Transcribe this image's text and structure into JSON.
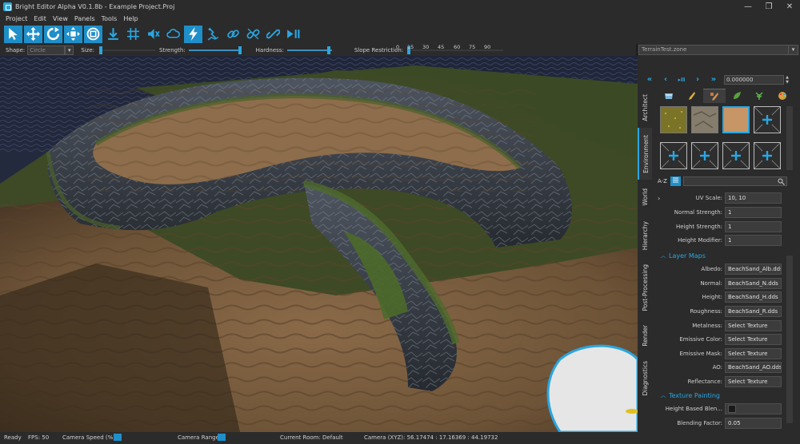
{
  "window": {
    "title": "Bright Editor Alpha V0.1.8b - Example Project.Proj",
    "controls": [
      "—",
      "❐",
      "✕"
    ]
  },
  "menu": [
    "Project",
    "Edit",
    "View",
    "Panels",
    "Tools",
    "Help"
  ],
  "toolbar": {
    "tools": [
      {
        "icon": "select-arrow-icon",
        "active": true
      },
      {
        "icon": "move-icon",
        "active": true
      },
      {
        "icon": "rotate-icon",
        "active": true
      },
      {
        "icon": "scale-icon",
        "active": true
      },
      {
        "icon": "bounds-icon",
        "active": true
      },
      {
        "icon": "drop-to-ground-icon",
        "active": false
      },
      {
        "icon": "grid-icon",
        "active": false
      },
      {
        "icon": "mute-icon",
        "active": false
      },
      {
        "icon": "cloud-icon",
        "active": false
      },
      {
        "icon": "lightning-icon",
        "active": true
      },
      {
        "icon": "terrain-brush-icon",
        "active": false
      },
      {
        "icon": "link-icon",
        "active": false
      },
      {
        "icon": "unlink-icon",
        "active": false
      },
      {
        "icon": "chain-icon",
        "active": false
      },
      {
        "icon": "play-pause-icon",
        "active": false
      }
    ]
  },
  "options": {
    "shape_label": "Shape:",
    "shape_value": "Circle",
    "size_label": "Size:",
    "strength_label": "Strength:",
    "hardness_label": "Hardness:",
    "slope_label": "Slope Restriction:",
    "slope_ticks": [
      "0",
      "15",
      "30",
      "45",
      "60",
      "75",
      "90"
    ],
    "size_value": 0.0,
    "strength_value": 1.0,
    "hardness_value": 1.0,
    "slope_value": 0.0
  },
  "scene": {
    "file": "TerrainTest.zone",
    "time_value": "0.000000",
    "playback": [
      "«",
      "‹",
      "▸II",
      "›",
      "»"
    ]
  },
  "vtabs": [
    "Architect",
    "Environment",
    "World",
    "Hierarchy",
    "Post-Processing",
    "Render",
    "Diagnostics"
  ],
  "environment": {
    "sort_label": "A-Z",
    "textures": [
      {
        "name": "grass",
        "color": "#8a8330"
      },
      {
        "name": "rock",
        "color": "#8c8270"
      },
      {
        "name": "sand",
        "color": "#c79566",
        "selected": true
      }
    ],
    "properties": [
      {
        "label": "UV Scale:",
        "value": "10, 10"
      },
      {
        "label": "Normal Strength:",
        "value": "1"
      },
      {
        "label": "Height Strength:",
        "value": "1"
      },
      {
        "label": "Height Modifier:",
        "value": "1"
      }
    ],
    "layer_maps_title": "Layer Maps",
    "layer_maps": [
      {
        "label": "Albedo:",
        "value": "BeachSand_Alb.dds"
      },
      {
        "label": "Normal:",
        "value": "BeachSand_N.dds"
      },
      {
        "label": "Height:",
        "value": "BeachSand_H.dds"
      },
      {
        "label": "Roughness:",
        "value": "BeachSand_R.dds"
      },
      {
        "label": "Metalness:",
        "value": "Select Texture"
      },
      {
        "label": "Emissive Color:",
        "value": "Select Texture"
      },
      {
        "label": "Emissive Mask:",
        "value": "Select Texture"
      },
      {
        "label": "AO:",
        "value": "BeachSand_AO.dds"
      },
      {
        "label": "Reflectance:",
        "value": "Select Texture"
      }
    ],
    "texture_painting_title": "Texture Painting",
    "height_blend_label": "Height Based Blen...",
    "blending_factor_label": "Blending Factor:",
    "blending_factor_value": "0.05"
  },
  "status": {
    "ready": "Ready",
    "fps": "FPS: 50",
    "camera_speed": "Camera  Speed (%):",
    "camera_range": "Camera Range:",
    "room": "Current Room: Default",
    "camera_xyz": "Camera (XYZ):   56.17474 : 17.16369 : 44.19732"
  },
  "colors": {
    "accent": "#2aa6e0",
    "panel": "#2b2b2b"
  }
}
